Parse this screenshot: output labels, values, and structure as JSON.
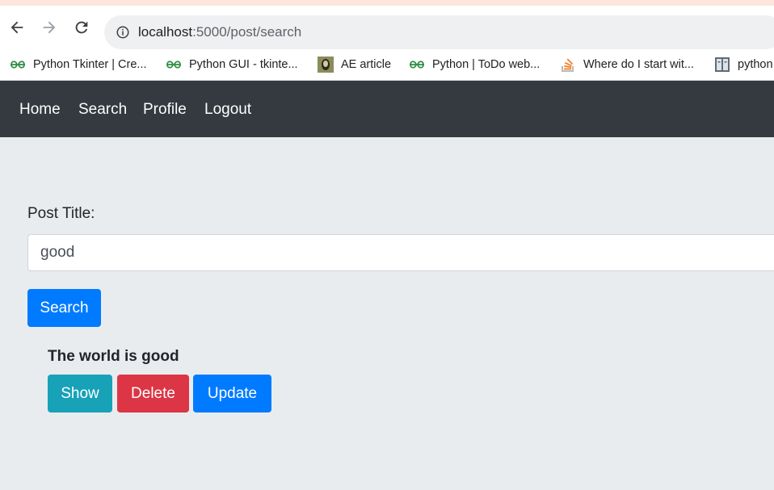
{
  "browser": {
    "url_host": "localhost",
    "url_port_path": ":5000/post/search",
    "bookmarks": [
      {
        "label": "Python Tkinter | Cre...",
        "icon": "geeksforgeeks-icon"
      },
      {
        "label": "Python GUI - tkinte...",
        "icon": "geeksforgeeks-icon"
      },
      {
        "label": "AE article",
        "icon": "avatar-icon"
      },
      {
        "label": "Python | ToDo web...",
        "icon": "geeksforgeeks-icon"
      },
      {
        "label": "Where do I start wit...",
        "icon": "stackoverflow-icon"
      },
      {
        "label": "python",
        "icon": "book-icon"
      }
    ]
  },
  "navbar": {
    "links": [
      "Home",
      "Search",
      "Profile",
      "Logout"
    ]
  },
  "search": {
    "label": "Post Title:",
    "value": "good",
    "button": "Search"
  },
  "result": {
    "title": "The world is good",
    "show": "Show",
    "delete": "Delete",
    "update": "Update"
  },
  "colors": {
    "navbar": "#343a40",
    "primary": "#007bff",
    "info": "#17a2b8",
    "danger": "#dc3545",
    "page_bg": "#e9ecef"
  }
}
